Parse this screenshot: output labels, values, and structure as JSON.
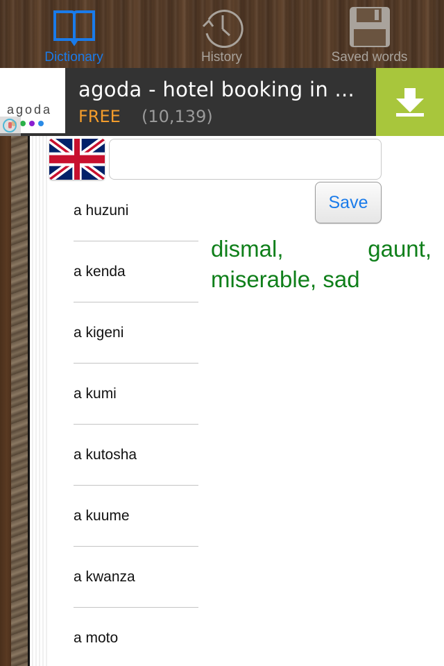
{
  "tabs": [
    {
      "label": "Dictionary",
      "icon": "book-icon",
      "active": true
    },
    {
      "label": "History",
      "icon": "history-clock-icon",
      "active": false
    },
    {
      "label": "Saved words",
      "icon": "floppy-disk-icon",
      "active": false
    }
  ],
  "ad": {
    "brand": "agoda",
    "title": "agoda - hotel booking in ...",
    "price": "FREE",
    "rating_count": "(10,139)",
    "download_icon": "download-icon",
    "dot_colors": [
      "#f39c2b",
      "#2bb14a",
      "#8a1fd1",
      "#2a8be6"
    ],
    "button_color": "#a8c63c"
  },
  "search": {
    "language_flag": "uk-flag",
    "value": "",
    "placeholder": "",
    "save_label": "Save"
  },
  "words": [
    "a huzuni",
    "a kenda",
    "a kigeni",
    "a kumi",
    "a kutosha",
    "a kuume",
    "a kwanza",
    "a moto"
  ],
  "definition": "dismal, gaunt, miserable, sad",
  "colors": {
    "accent": "#1a7bea",
    "definition": "#0f7f1a",
    "inactive_tab": "#a9a39c"
  }
}
